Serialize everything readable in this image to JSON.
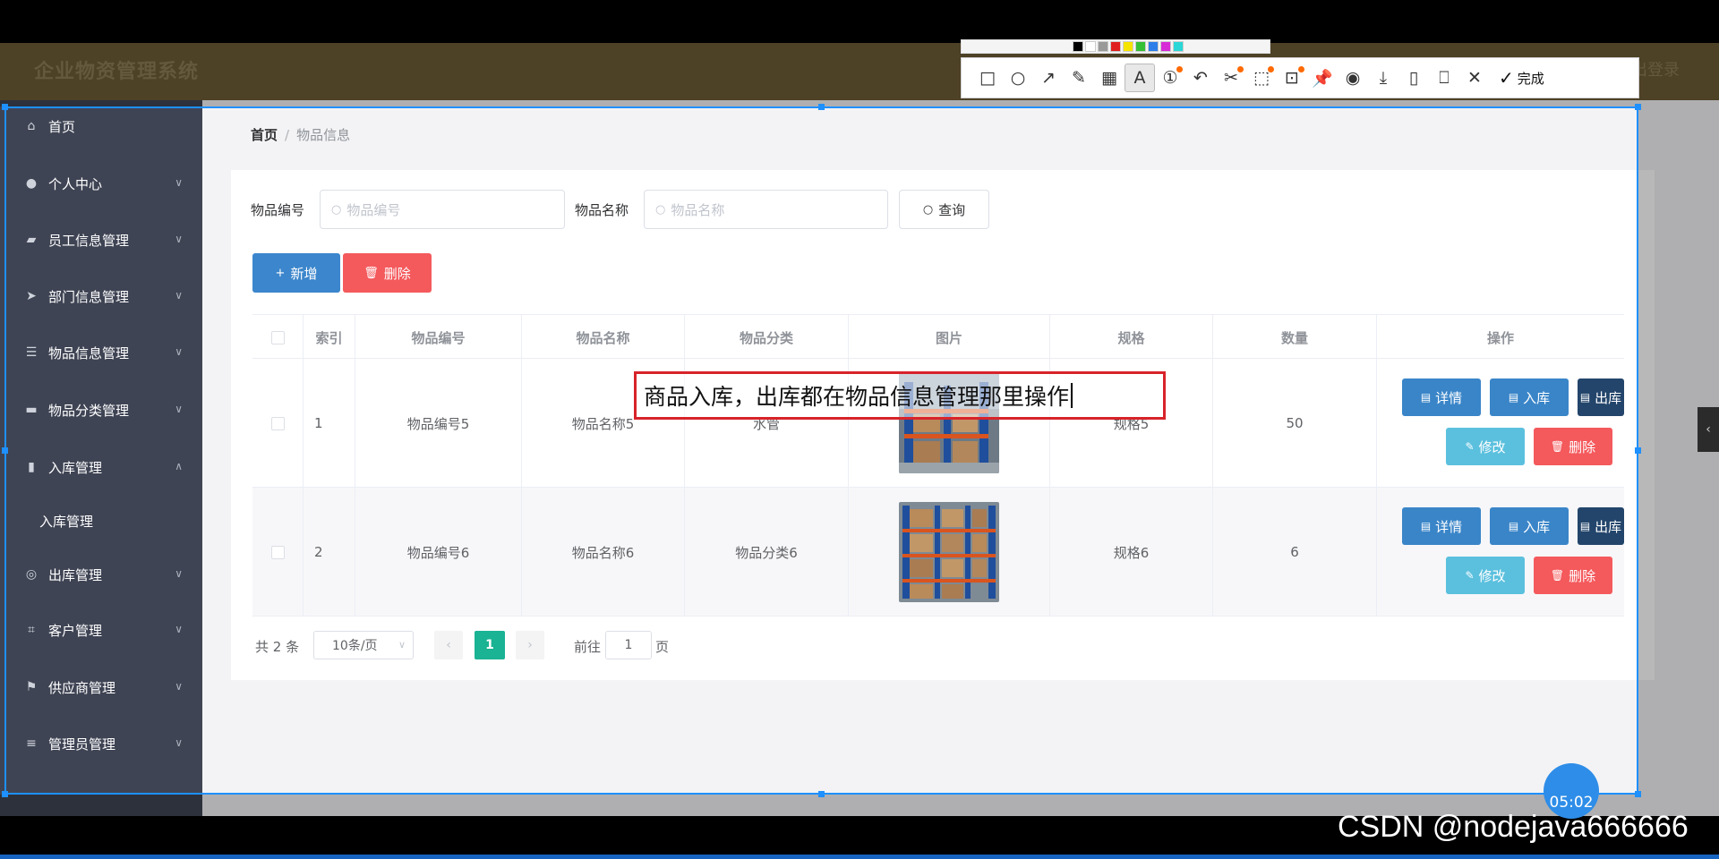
{
  "app": {
    "title": "企业物资管理系统",
    "logout": "退出登录"
  },
  "sidebar": {
    "items": [
      {
        "label": "首页",
        "icon": "home-icon"
      },
      {
        "label": "个人中心",
        "icon": "user-icon"
      },
      {
        "label": "员工信息管理",
        "icon": "briefcase-icon"
      },
      {
        "label": "部门信息管理",
        "icon": "send-icon"
      },
      {
        "label": "物品信息管理",
        "icon": "list-icon"
      },
      {
        "label": "物品分类管理",
        "icon": "chat-icon"
      },
      {
        "label": "入库管理",
        "icon": "bars-icon"
      },
      {
        "label": "出库管理",
        "icon": "compass-icon"
      },
      {
        "label": "客户管理",
        "icon": "crop-icon"
      },
      {
        "label": "供应商管理",
        "icon": "flag-icon"
      },
      {
        "label": "管理员管理",
        "icon": "sliders-icon"
      }
    ],
    "sub_item": "入库管理"
  },
  "breadcrumb": {
    "home": "首页",
    "sep": "/",
    "current": "物品信息"
  },
  "search": {
    "code_label": "物品编号",
    "code_placeholder": "物品编号",
    "name_label": "物品名称",
    "name_placeholder": "物品名称",
    "query_label": "查询"
  },
  "actions": {
    "add": "新增",
    "delete": "删除"
  },
  "table": {
    "columns": [
      "索引",
      "物品编号",
      "物品名称",
      "物品分类",
      "图片",
      "规格",
      "数量",
      "操作"
    ],
    "rows": [
      {
        "index": "1",
        "code": "物品编号5",
        "name": "物品名称5",
        "category": "水管",
        "spec": "规格5",
        "qty": "50"
      },
      {
        "index": "2",
        "code": "物品编号6",
        "name": "物品名称6",
        "category": "物品分类6",
        "spec": "规格6",
        "qty": "6"
      }
    ],
    "row_buttons": {
      "detail": "详情",
      "in": "入库",
      "out": "出库",
      "edit": "修改",
      "delete": "删除"
    }
  },
  "pagination": {
    "total": "共 2 条",
    "page_size": "10条/页",
    "current": "1",
    "goto_prefix": "前往",
    "goto_value": "1",
    "goto_suffix": "页"
  },
  "annotation": {
    "text": "商品入库，出库都在物品信息管理那里操作"
  },
  "toolbar": {
    "done": "完成"
  },
  "timer": "05:02",
  "watermark": "CSDN @nodejava666666",
  "colors": {
    "header": "#6b5a35",
    "sidebar": "#3f4454",
    "primary": "#3b86cc",
    "danger": "#f4595c",
    "success": "#1ab394",
    "annotation": "#d8232a"
  }
}
